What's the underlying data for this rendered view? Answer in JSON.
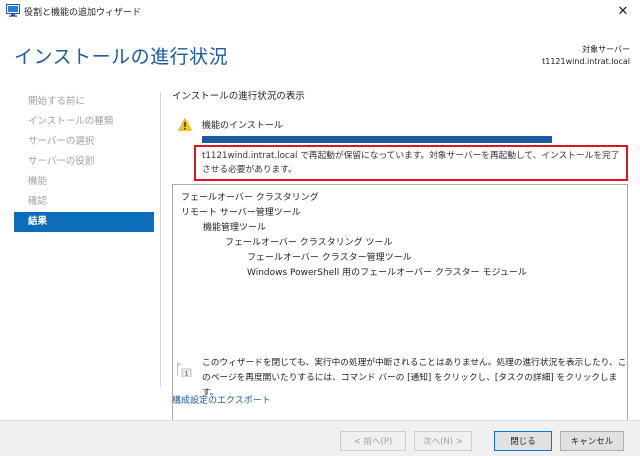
{
  "window": {
    "title": "役割と機能の追加ウィザード",
    "close_glyph": "✕"
  },
  "header": {
    "page_title": "インストールの進行状況",
    "target_server_label": "対象サーバー",
    "target_server_value": "t1121wind.intrat.local"
  },
  "nav": {
    "items": [
      {
        "label": "開始する前に",
        "active": false
      },
      {
        "label": "インストールの種類",
        "active": false
      },
      {
        "label": "サーバーの選択",
        "active": false
      },
      {
        "label": "サーバーの役割",
        "active": false
      },
      {
        "label": "機能",
        "active": false
      },
      {
        "label": "確認",
        "active": false
      },
      {
        "label": "結果",
        "active": true
      }
    ]
  },
  "main": {
    "section_title": "インストールの進行状況の表示",
    "feature_install_label": "機能のインストール",
    "progress_fraction": 1.0,
    "notice": "t1121wind.intrat.local で再起動が保留になっています。対象サーバーを再起動して、インストールを完了させる必要があります。",
    "feature_tree": [
      {
        "label": "フェールオーバー クラスタリング",
        "level": 0
      },
      {
        "label": "リモート サーバー管理ツール",
        "level": 0
      },
      {
        "label": "機能管理ツール",
        "level": 1
      },
      {
        "label": "フェールオーバー クラスタリング ツール",
        "level": 2
      },
      {
        "label": "フェールオーバー クラスター管理ツール",
        "level": 3
      },
      {
        "label": "Windows PowerShell 用のフェールオーバー クラスター モジュール",
        "level": 3
      }
    ],
    "info_text": "このウィザードを閉じても、実行中の処理が中断されることはありません。処理の進行状況を表示したり、このページを再度開いたりするには、コマンド バーの [通知] をクリックし、[タスクの詳細] をクリックします。",
    "info_badge": "1",
    "export_link": "構成設定のエクスポート"
  },
  "footer": {
    "prev_label": "< 前へ(P)",
    "next_label": "次へ(N) >",
    "close_label": "閉じる",
    "cancel_label": "キャンセル"
  },
  "colors": {
    "accent": "#1e5aa0",
    "nav_active": "#0c6dbb",
    "notice_border": "#e0141e",
    "warning": "#f2c811"
  }
}
